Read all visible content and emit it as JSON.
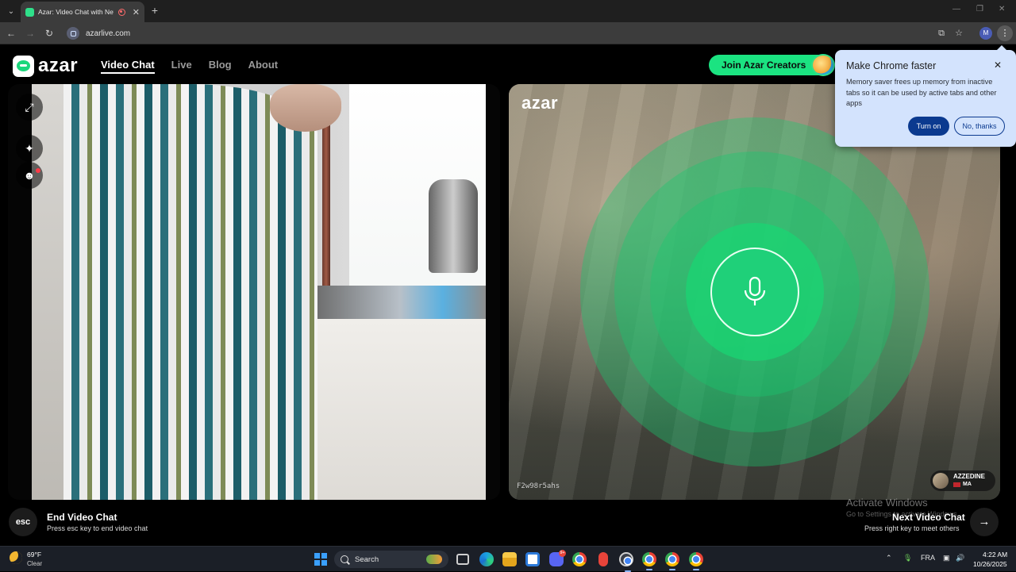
{
  "browser": {
    "tab_title": "Azar: Video Chat with New",
    "tab_close_label": "✕",
    "new_tab_label": "+",
    "url": "azarlive.com",
    "profile_initial": "M",
    "icons": [
      "tab-search-icon",
      "back-icon",
      "forward-icon",
      "reload-icon",
      "site-info-icon",
      "cast-icon",
      "bookmark-star-icon",
      "menu-kebab-icon",
      "recording-icon"
    ]
  },
  "site": {
    "logo_text": "azar",
    "nav": [
      {
        "label": "Video Chat",
        "active": true
      },
      {
        "label": "Live",
        "active": false
      },
      {
        "label": "Blog",
        "active": false
      },
      {
        "label": "About",
        "active": false
      }
    ],
    "join_button": "Join Azar Creators",
    "brand_color": "#1be381"
  },
  "video": {
    "side_tools": [
      "expand-icon",
      "sparkle-effects-icon",
      "sticker-face-icon"
    ],
    "remote_logo": "azar",
    "remote_user_id": "F2w98r5ahs",
    "remote_user_name": "AZZEDINE",
    "remote_user_country": "MA",
    "mic_icon": "microphone-icon"
  },
  "popup": {
    "title": "Make Chrome faster",
    "close_label": "✕",
    "body": "Memory saver frees up memory from inactive tabs so it can be used by active tabs and other apps",
    "primary_button": "Turn on",
    "secondary_button": "No, thanks"
  },
  "bottom": {
    "esc_key": "esc",
    "end_title": "End Video Chat",
    "end_subtitle": "Press esc key to end video chat",
    "next_title": "Next Video Chat",
    "next_subtitle": "Press right key to meet others",
    "next_arrow": "→",
    "watermark_title": "Activate Windows",
    "watermark_sub": "Go to Settings to activate Windows."
  },
  "taskbar": {
    "weather_temp": "69°F",
    "weather_desc": "Clear",
    "search_placeholder": "Search",
    "apps": [
      "task-view-icon",
      "edge-icon",
      "file-explorer-icon",
      "store-icon",
      "discord-icon",
      "chrome-icon",
      "microphone-app-icon",
      "chrome-active-icon",
      "chrome-profile-icon",
      "chrome-profile-2-icon",
      "chrome-profile-3-icon"
    ],
    "discord_badge": "9+",
    "language": "FRA",
    "time": "4:22 AM",
    "date": "10/26/2025"
  }
}
